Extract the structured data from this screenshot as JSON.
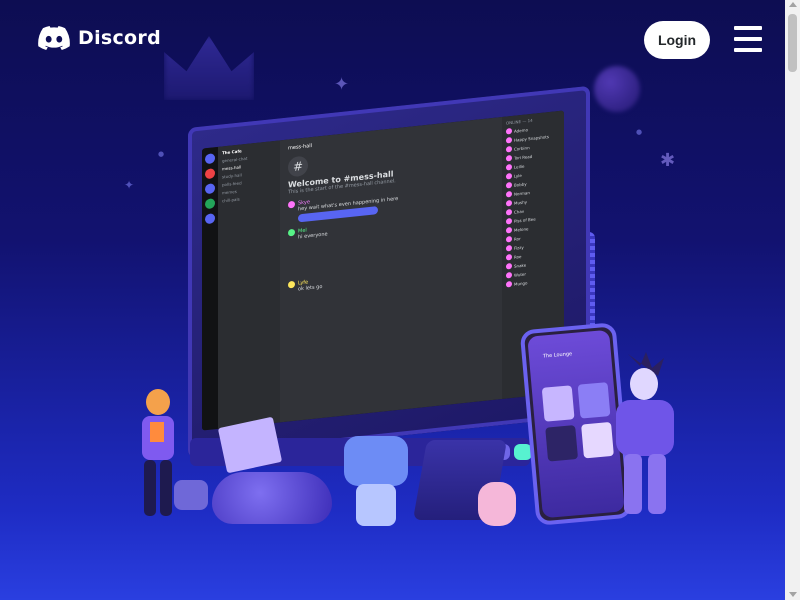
{
  "brand": {
    "name": "Discord",
    "logo_icon": "discord-controller-icon"
  },
  "header": {
    "login_label": "Login",
    "menu_icon": "hamburger-menu-icon"
  },
  "app_window": {
    "server_name": "The Cafe",
    "channel_name": "mess-hall",
    "welcome_title": "Welcome to #mess-hall",
    "welcome_sub": "This is the start of the #mess-hall channel.",
    "channels": [
      "general-chat",
      "mess-hall",
      "study-hall",
      "polls-feed",
      "memes",
      "chill-pals"
    ],
    "messages": [
      {
        "author": "Skye",
        "text": "hey wait what's even happening in here"
      },
      {
        "author": "Mel",
        "text": "hi everyone"
      },
      {
        "author": "Lyfe",
        "text": "ok lets go"
      }
    ],
    "members_heading": "ONLINE — 14",
    "members": [
      "Ademo",
      "Happy Snapshots",
      "Corbinn",
      "Tori Read",
      "Leilie",
      "Lyle",
      "Bobby",
      "Norman",
      "Mushy",
      "Chav",
      "Piss of Bee",
      "Melone",
      "Ror",
      "Fizzy",
      "Roe",
      "Snake",
      "Wuter",
      "Mungo"
    ]
  },
  "phone": {
    "title": "The Lounge"
  }
}
